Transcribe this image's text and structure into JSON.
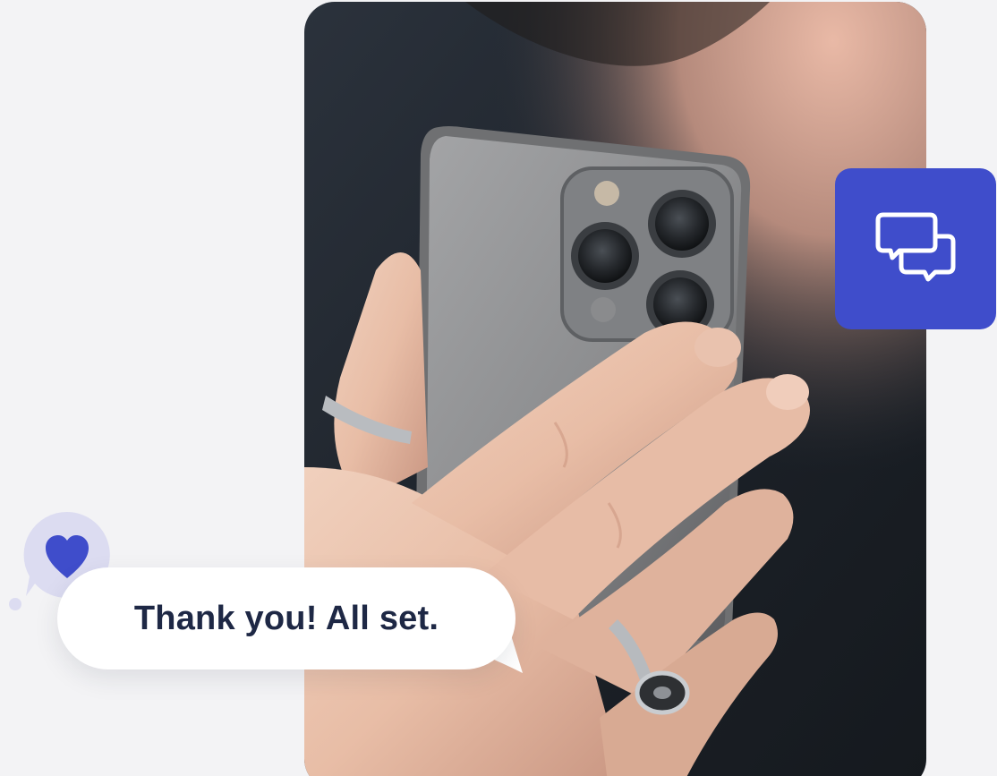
{
  "message": {
    "text": "Thank you! All set."
  },
  "icons": {
    "badge": "chat-bubbles-icon",
    "reaction": "heart-icon"
  },
  "colors": {
    "accent": "#3f4dcb",
    "bubble_tint": "#dcdcf1",
    "text_dark": "#1e2845",
    "page_background": "#f3f3f5"
  },
  "photo": {
    "subject": "hand holding phone"
  }
}
